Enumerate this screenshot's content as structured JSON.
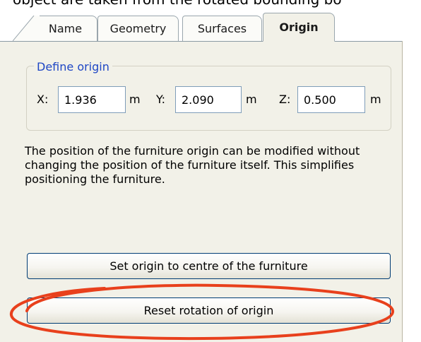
{
  "caption": "object are taken from the rotated bounding bo",
  "tabs": [
    {
      "label": "Name",
      "active": false
    },
    {
      "label": "Geometry",
      "active": false
    },
    {
      "label": "Surfaces",
      "active": false
    },
    {
      "label": "Origin",
      "active": true
    }
  ],
  "origin_group": {
    "title": "Define origin",
    "x": {
      "label": "X:",
      "value": "1.936",
      "unit": "m"
    },
    "y": {
      "label": "Y:",
      "value": "2.090",
      "unit": "m"
    },
    "z": {
      "label": "Z:",
      "value": "0.500",
      "unit": "m"
    }
  },
  "description": "The position of the furniture origin can be modified without changing the position of the furniture itself. This simplifies positioning the furniture.",
  "buttons": {
    "set_origin": "Set origin to centre of the furniture",
    "reset_rotation": "Reset rotation of origin"
  },
  "colors": {
    "panel_bg": "#f2f1e8",
    "group_title": "#1f47c5",
    "highlight": "#e8401c"
  }
}
